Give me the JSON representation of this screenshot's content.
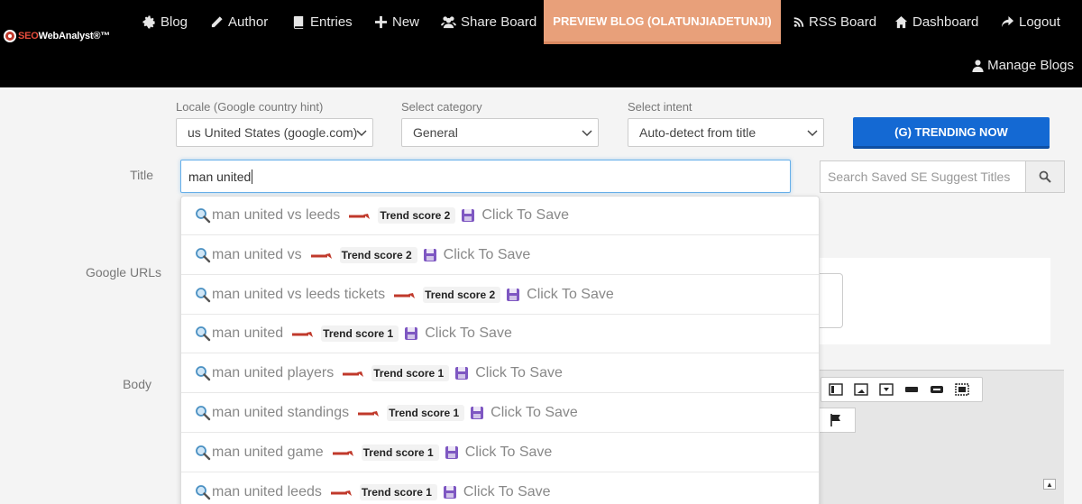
{
  "brand": {
    "seo": "SEO",
    "rest": "WebAnalyst®™"
  },
  "nav": {
    "blog": "Blog",
    "author": "Author",
    "entries": "Entries",
    "new": "New",
    "share_board": "Share Board",
    "preview": "PREVIEW BLOG (OLATUNJIADETUNJI)",
    "rss_board": "RSS Board",
    "dashboard": "Dashboard",
    "logout": "Logout",
    "manage_blogs": "Manage Blogs"
  },
  "form": {
    "locale_label": "Locale (Google country hint)",
    "locale_value": "us United States (google.com)",
    "category_label": "Select category",
    "category_value": "General",
    "intent_label": "Select intent",
    "intent_value": "Auto-detect from title",
    "trending_button": "(G) TRENDING NOW",
    "title_label": "Title",
    "title_value": "man united",
    "search_saved_placeholder": "Search Saved SE Suggest Titles",
    "google_urls_label": "Google URLs",
    "body_label": "Body"
  },
  "suggestions": [
    {
      "text": "man united vs leeds",
      "score": "Trend score 2",
      "save": "Click To Save"
    },
    {
      "text": "man united vs",
      "score": "Trend score 2",
      "save": "Click To Save"
    },
    {
      "text": "man united vs leeds tickets",
      "score": "Trend score 2",
      "save": "Click To Save"
    },
    {
      "text": "man united",
      "score": "Trend score 1",
      "save": "Click To Save"
    },
    {
      "text": "man united players",
      "score": "Trend score 1",
      "save": "Click To Save"
    },
    {
      "text": "man united standings",
      "score": "Trend score 1",
      "save": "Click To Save"
    },
    {
      "text": "man united game",
      "score": "Trend score 1",
      "save": "Click To Save"
    },
    {
      "text": "man united leeds",
      "score": "Trend score 1",
      "save": "Click To Save"
    }
  ],
  "colors": {
    "preview_accent": "#e8a07a",
    "trending_blue": "#1469d3",
    "nav_bg": "#000000"
  }
}
